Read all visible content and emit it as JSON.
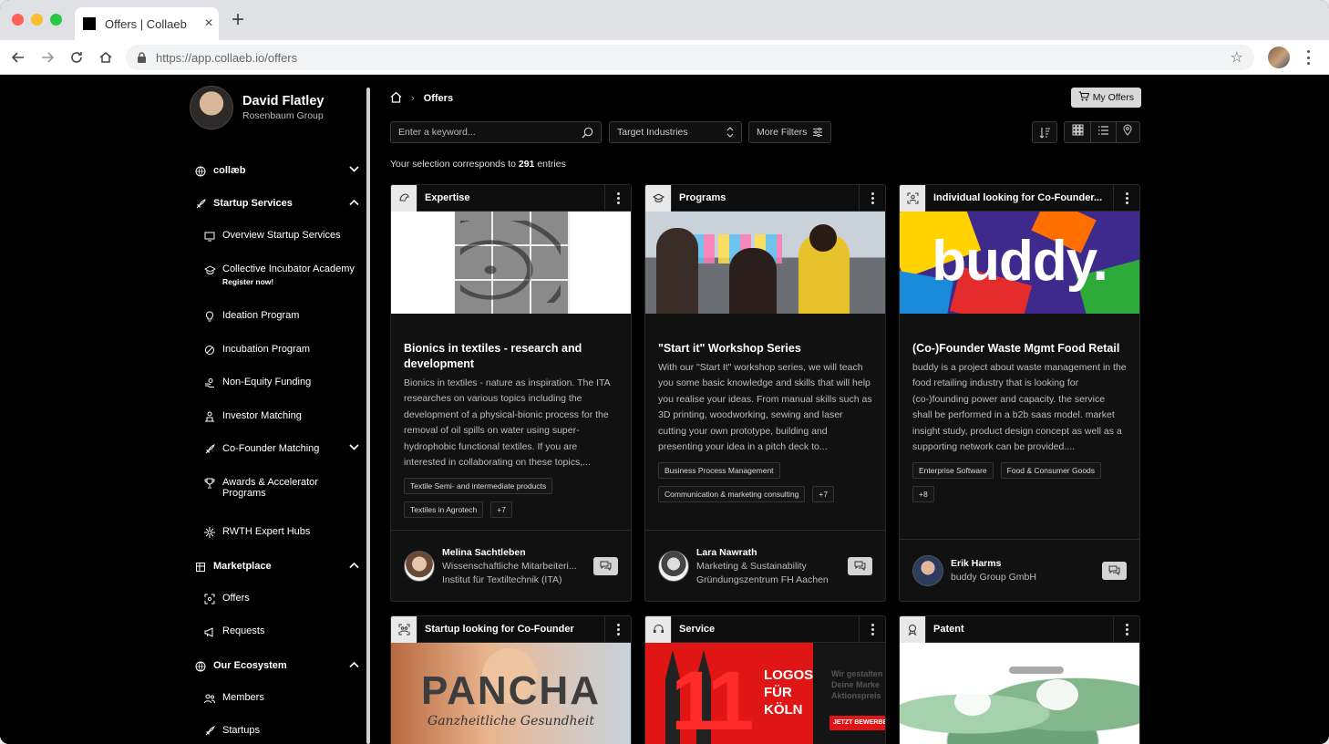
{
  "browser": {
    "tab_title": "Offers | Collaeb",
    "url": "https://app.collaeb.io/offers",
    "traffic_colors": [
      "#ff5f57",
      "#febc2e",
      "#28c840"
    ]
  },
  "user": {
    "name": "David Flatley",
    "org": "Rosenbaum Group"
  },
  "sidebar": {
    "collaeb": "collæb",
    "startup_services": "Startup Services",
    "items": [
      "Overview Startup Services",
      "Collective Incubator Academy",
      "Ideation Program",
      "Incubation Program",
      "Non-Equity Funding",
      "Investor Matching",
      "Co-Founder Matching",
      "Awards & Accelerator",
      "RWTH Expert Hubs"
    ],
    "academy_note": "Register now!",
    "awards_line2": "Programs",
    "marketplace": "Marketplace",
    "market_items": [
      "Offers",
      "Requests"
    ],
    "ecosystem": "Our Ecosystem",
    "eco_items": [
      "Members",
      "Startups"
    ]
  },
  "main": {
    "breadcrumb": "Offers",
    "my_offers": "My Offers",
    "search_placeholder": "Enter a keyword...",
    "industries": "Target Industries",
    "more_filters": "More Filters",
    "count_prefix": "Your selection corresponds to ",
    "count_value": "291",
    "count_suffix": " entries"
  },
  "cards": [
    {
      "type": "Expertise",
      "title": "Bionics in textiles - research and development",
      "desc": "Bionics in textiles - nature as inspiration. The ITA researches on various topics including the development of a physical-bionic process for the removal of oil spills on water using super-hydrophobic functional textiles. If you are interested in collaborating on these topics,...",
      "tags": [
        "Textile Semi- and intermediate products",
        "Textiles in Agrotech",
        "+7"
      ],
      "person": "Melina Sachtleben",
      "role": "Wissenschaftliche Mitarbeiteri...",
      "company": "Institut für Textiltechnik (ITA)"
    },
    {
      "type": "Programs",
      "title": "\"Start it\" Workshop Series",
      "desc": "With our \"Start It\" workshop series, we will teach you some basic knowledge and skills that will help you realise your ideas. From manual skills such as 3D printing, woodworking, sewing and laser cutting your own prototype, building and presenting your idea in a pitch deck to...",
      "tags": [
        "Business Process Management",
        "Communication & marketing consulting",
        "+7"
      ],
      "person": "Lara Nawrath",
      "role": "Marketing & Sustainability",
      "company": "Gründungszentrum FH Aachen"
    },
    {
      "type": "Individual looking for Co-Founder...",
      "title": "(Co-)Founder Waste Mgmt Food Retail",
      "desc": "buddy is a project about waste management in the food retailing industry that is looking for (co-)founding power and capacity. the service shall be performed in a b2b saas model. market insight study, product design concept as well as a supporting network can be provided....",
      "tags": [
        "Enterprise Software",
        "Food & Consumer Goods",
        "+8"
      ],
      "person": "Erik Harms",
      "company": "buddy Group GmbH",
      "banner_text": "buddy."
    },
    {
      "type": "Startup looking for Co-Founder",
      "banner_text": "PANCHA",
      "banner_sub": "Ganzheitliche Gesundheit"
    },
    {
      "type": "Service",
      "banner_num": "11",
      "banner_lines": [
        "LOGOS",
        "FÜR",
        "KÖLN"
      ],
      "banner_side": "Wir gestalten Deine Marke Aktionspreis",
      "banner_cta": "JETZT BEWERBEN"
    },
    {
      "type": "Patent"
    }
  ]
}
